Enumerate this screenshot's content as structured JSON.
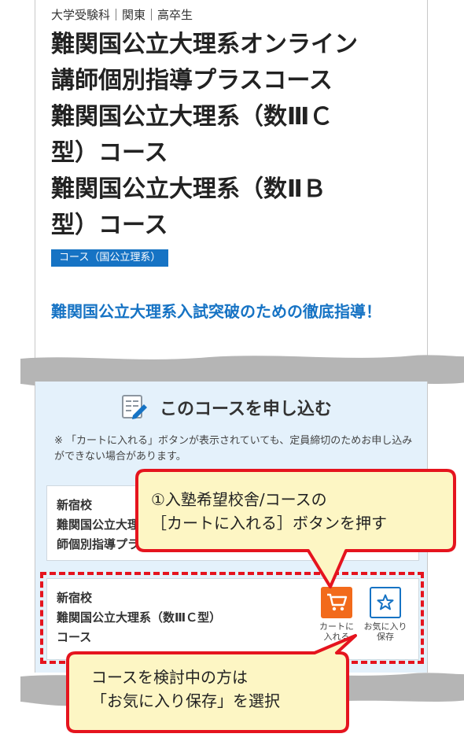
{
  "breadcrumb": "大学受験科｜関東｜高卒生",
  "course_title_lines": [
    "難関国公立大理系オンライン",
    "講師個別指導プラスコース",
    "難関国公立大理系（数ⅢＣ",
    "型）コース",
    "難関国公立大理系（数ⅡＢ",
    "型）コース"
  ],
  "category_badge": "コース（国公立理系）",
  "catch_copy": "難関国公立大理系入試突破のための徹底指導！",
  "apply": {
    "heading": "このコースを申し込む",
    "note": "※ 「カートに入れる」ボタンが表示されていても、定員締切のためお申し込みができない場合があります。"
  },
  "school_cards": [
    {
      "school": "新宿校",
      "course_lines": [
        "難関国公立大理系オンライン講",
        "師個別指導プラスコース"
      ]
    },
    {
      "school": "新宿校",
      "course_lines": [
        "難関国公立大理系（数ⅢＣ型）",
        "コース"
      ]
    }
  ],
  "buttons": {
    "cart_label": "カートに入れる",
    "cart_label_lines": [
      "カートに",
      "入れる"
    ],
    "favorite_label": "お気に入り保存",
    "favorite_label_lines": [
      "お気に入り",
      "保存"
    ]
  },
  "callouts": {
    "step1_lines": [
      "①入塾希望校舎/コースの",
      "［カートに入れる］ボタンを押す"
    ],
    "step2_lines": [
      "コースを検討中の方は",
      "「お気に入り保存」を選択"
    ]
  },
  "colors": {
    "brand_blue": "#1673c4",
    "cart_orange": "#f26a1b",
    "highlight_red": "#e5141e",
    "callout_fill": "#fdf6c4",
    "apply_background": "#e4f1fb"
  },
  "icons": {
    "apply_heading": "form-pencil-icon",
    "cart": "cart-icon",
    "favorite": "star-icon"
  }
}
